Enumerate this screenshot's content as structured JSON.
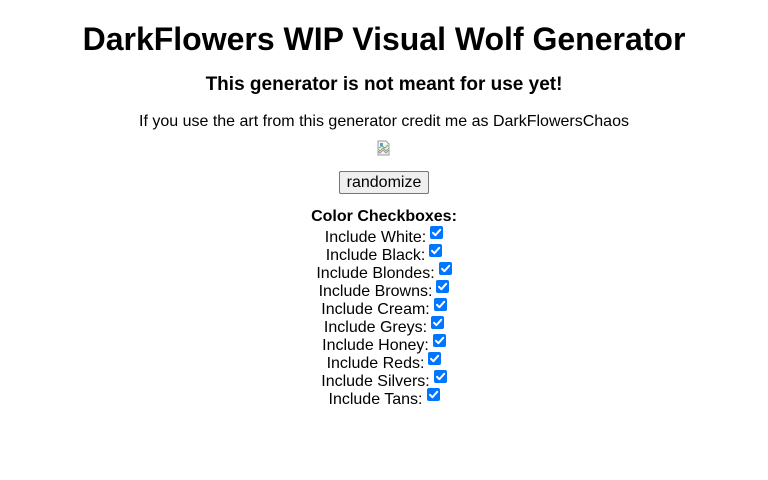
{
  "header": {
    "title": "DarkFlowers WIP Visual Wolf Generator",
    "subtitle": "This generator is not meant for use yet!",
    "credit": "If you use the art from this generator credit me as DarkFlowersChaos"
  },
  "image": {
    "icon": "broken-image-icon"
  },
  "randomize_label": "randomize",
  "checkboxes": {
    "title": "Color Checkboxes:",
    "items": [
      {
        "label": "Include White:",
        "checked": true
      },
      {
        "label": "Include Black:",
        "checked": true
      },
      {
        "label": "Include Blondes:",
        "checked": true
      },
      {
        "label": "Include Browns:",
        "checked": true
      },
      {
        "label": "Include Cream:",
        "checked": true
      },
      {
        "label": "Include Greys:",
        "checked": true
      },
      {
        "label": "Include Honey:",
        "checked": true
      },
      {
        "label": "Include Reds:",
        "checked": true
      },
      {
        "label": "Include Silvers:",
        "checked": true
      },
      {
        "label": "Include Tans:",
        "checked": true
      }
    ]
  },
  "colors": {
    "checkbox_accent": "#0075ff"
  }
}
